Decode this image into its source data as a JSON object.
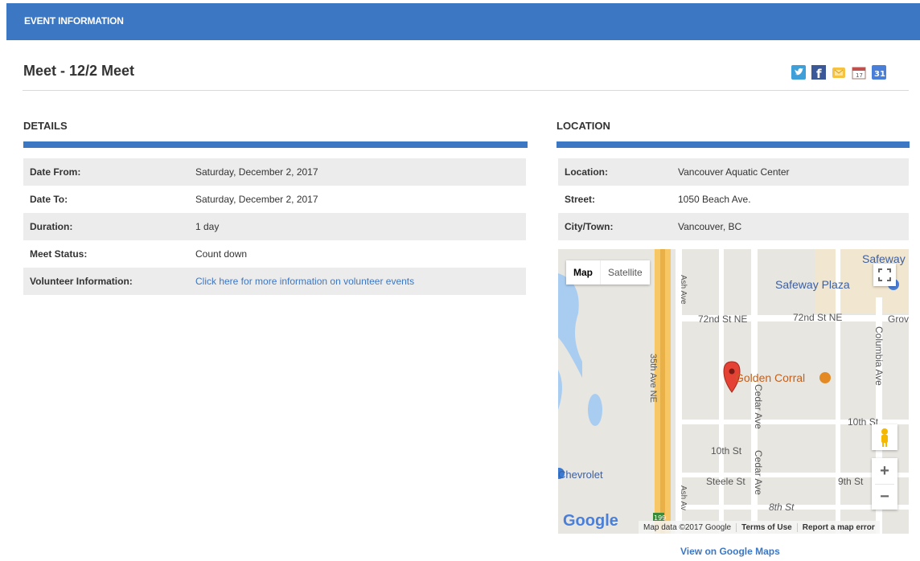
{
  "header": {
    "title": "EVENT INFORMATION"
  },
  "event": {
    "title": "Meet - 12/2 Meet"
  },
  "share_icons": [
    "twitter-icon",
    "facebook-icon",
    "outlook-icon",
    "ical-icon",
    "google-calendar-icon"
  ],
  "google_calendar_icon_text": "31",
  "details": {
    "heading": "DETAILS",
    "rows": [
      {
        "label": "Date From:",
        "value": "Saturday, December 2, 2017"
      },
      {
        "label": "Date To:",
        "value": "Saturday, December 2, 2017"
      },
      {
        "label": "Duration:",
        "value": "1 day"
      },
      {
        "label": "Meet Status:",
        "value": "Count down"
      },
      {
        "label": "Volunteer Information:",
        "value": "Click here for more information on volunteer events"
      }
    ]
  },
  "location": {
    "heading": "LOCATION",
    "rows": [
      {
        "label": "Location:",
        "value": "Vancouver Aquatic Center"
      },
      {
        "label": "Street:",
        "value": "1050 Beach Ave."
      },
      {
        "label": "City/Town:",
        "value": "Vancouver, BC"
      }
    ]
  },
  "map": {
    "type_map": "Map",
    "type_satellite": "Satellite",
    "zoom_in": "+",
    "zoom_out": "−",
    "logo": "Google",
    "attribution": "Map data ©2017 Google",
    "terms": "Terms of Use",
    "report": "Report a map error",
    "labels": {
      "safeway_plaza": "Safeway Plaza",
      "safeway": "Safeway",
      "ash_ave": "Ash Ave",
      "ash_ave_2": "Ash Av",
      "st_72nd_ne_1": "72nd St NE",
      "st_72nd_ne_2": "72nd St NE",
      "grov": "Grov",
      "columbia_ave": "Columbia Ave",
      "ave_35th_ne": "35th Ave NE",
      "golden_corral": "Golden Corral",
      "cedar_ave_1": "Cedar Ave",
      "cedar_ave_2": "Cedar Ave",
      "st_10th_1": "10th St",
      "st_10th_2": "10th St",
      "chevrolet": "Chevrolet",
      "steele_st": "Steele St",
      "st_9th": "9th St",
      "st_8th": "8th St",
      "shield_199": "199"
    },
    "view_link": "View on Google Maps"
  }
}
